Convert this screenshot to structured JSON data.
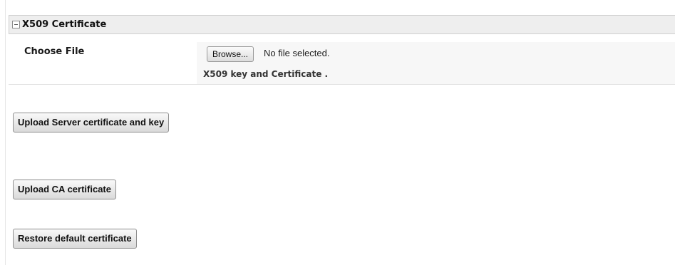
{
  "section": {
    "title": "X509 Certificate",
    "collapse_icon": "collapse-minus-icon"
  },
  "file_row": {
    "label": "Choose File",
    "browse_label": "Browse...",
    "status_text": "No file selected.",
    "help_text": "X509 key and Certificate ."
  },
  "actions": {
    "upload_server_label": "Upload Server certificate and key",
    "upload_ca_label": "Upload CA certificate",
    "restore_default_label": "Restore default certificate"
  }
}
